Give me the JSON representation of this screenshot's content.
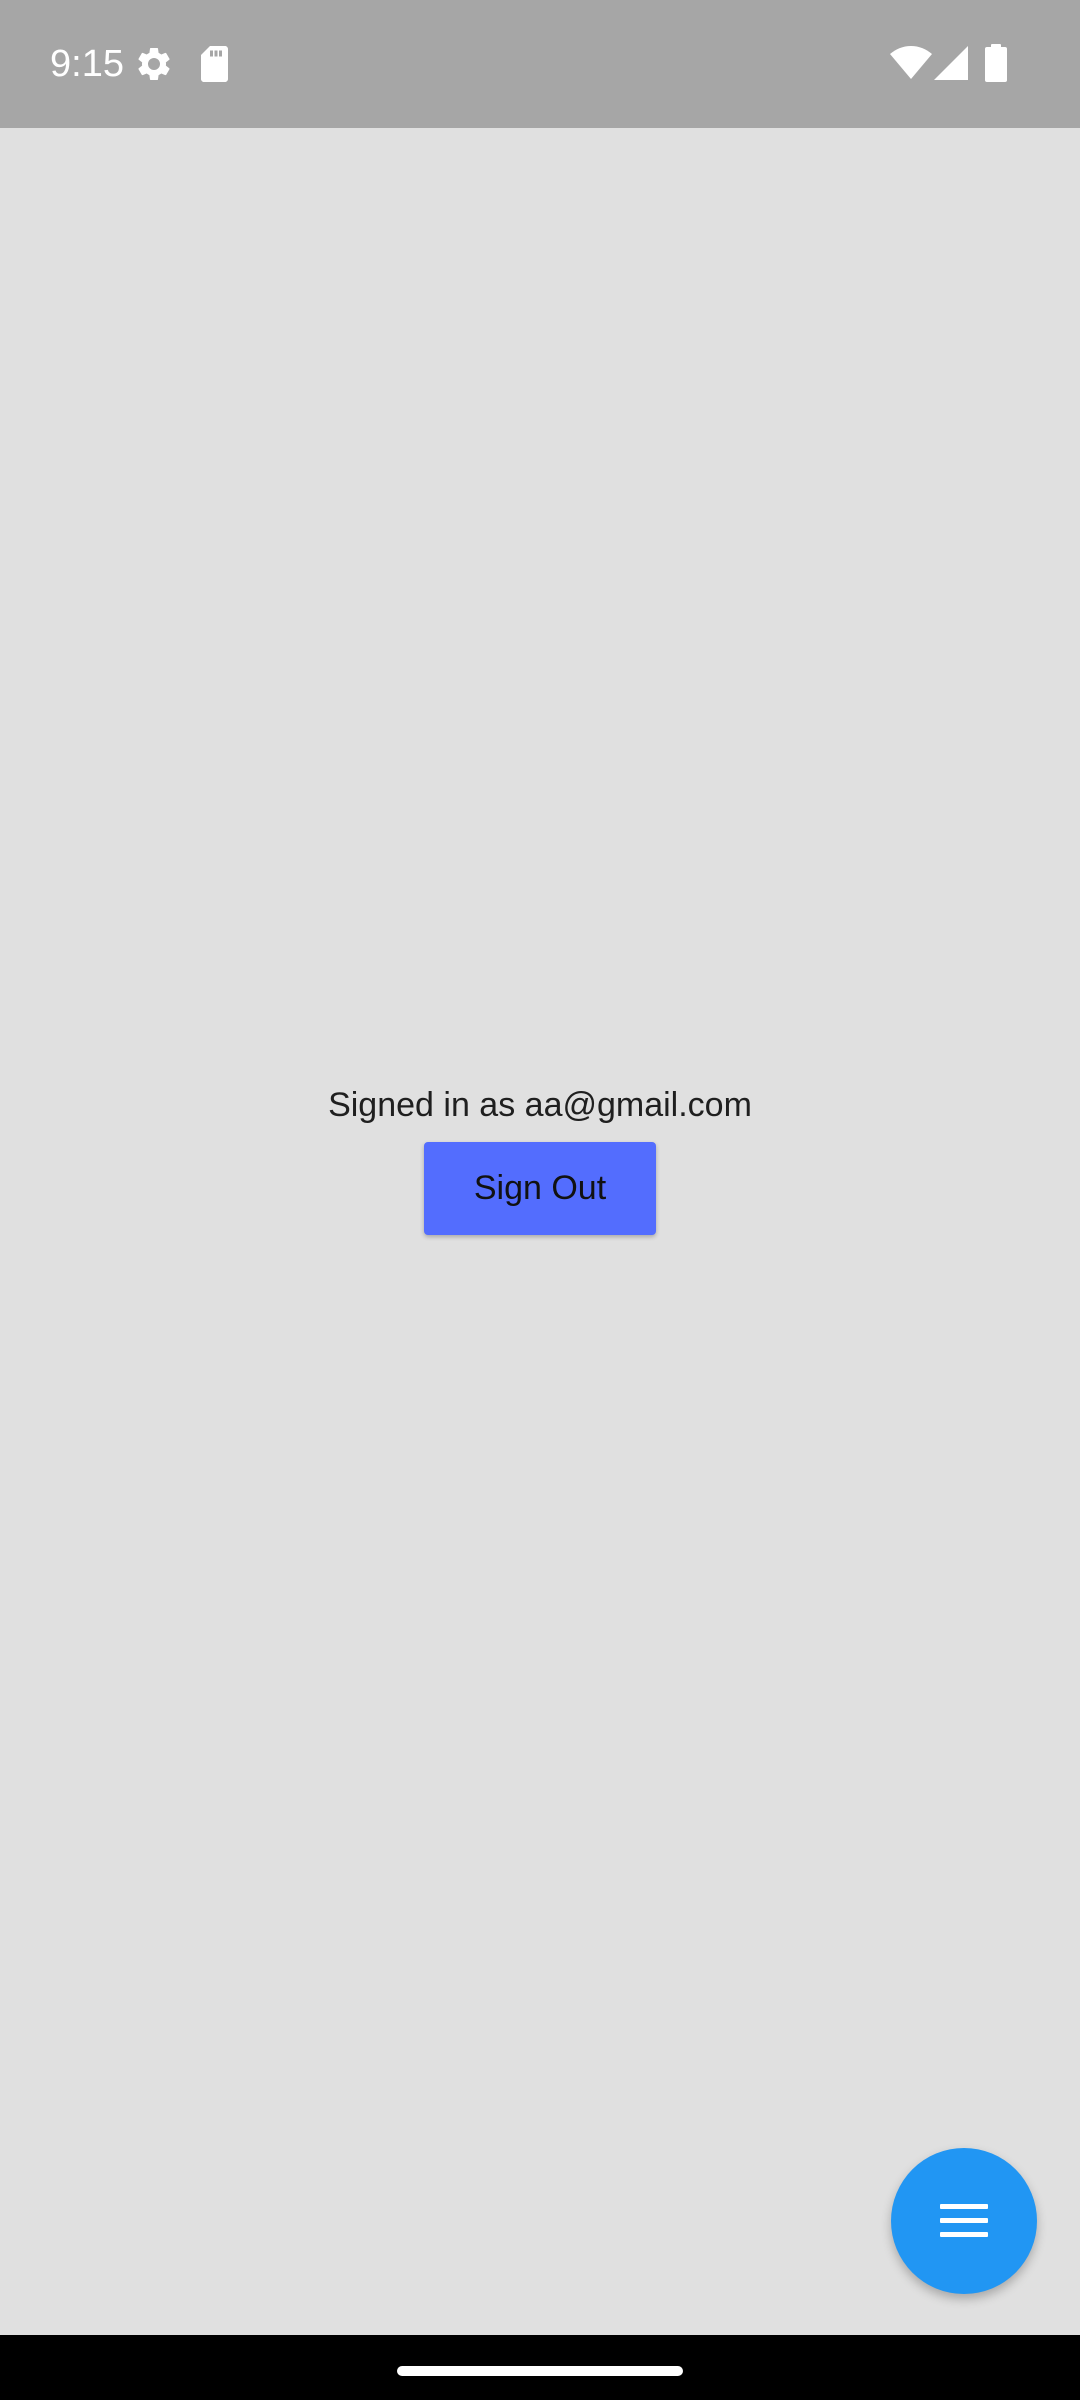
{
  "status_bar": {
    "time": "9:15",
    "icons": [
      "settings-gear-icon",
      "sd-card-icon",
      "wifi-icon",
      "cell-signal-icon",
      "battery-icon"
    ]
  },
  "main": {
    "signed_in_text": "Signed in as aa@gmail.com",
    "sign_out_label": "Sign Out"
  },
  "fab": {
    "icon": "menu-icon"
  },
  "colors": {
    "status_bar_bg": "#a6a6a6",
    "background": "#e0e0e0",
    "button": "#536dfe",
    "fab": "#2196f3",
    "nav_bar": "#000000"
  }
}
